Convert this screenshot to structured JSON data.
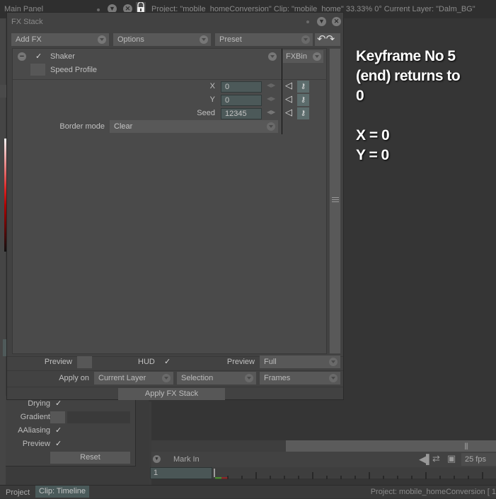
{
  "main_panel": {
    "title": "Main Panel",
    "info": "Project:  \"mobile_homeConversion\"  Clip: \"mobile_home\"   33.33%   0°  Current Layer: \"Dalm_BG\""
  },
  "fx_stack": {
    "title": "FX Stack",
    "toolbar": {
      "add_fx": "Add FX",
      "options": "Options",
      "preset": "Preset"
    },
    "effect": {
      "name": "Shaker",
      "enabled": true,
      "speed_profile_label": "Speed Profile",
      "fxbin_label": "FXBin",
      "params": [
        {
          "label": "X",
          "value": "0"
        },
        {
          "label": "Y",
          "value": "0"
        },
        {
          "label": "Seed",
          "value": "12345"
        }
      ],
      "border_mode_label": "Border mode",
      "border_mode_value": "Clear"
    },
    "bottom": {
      "preview_label": "Preview",
      "hud_label": "HUD",
      "hud_checked": true,
      "preview2_label": "Preview",
      "preview2_value": "Full",
      "apply_on_label": "Apply on",
      "apply_on_value": "Current Layer",
      "selection_value": "Selection",
      "frames_value": "Frames",
      "apply_button": "Apply FX Stack"
    }
  },
  "left_panel": {
    "rows": [
      {
        "label": "Drying",
        "checked": true
      },
      {
        "label": "Gradient",
        "checked": false
      },
      {
        "label": "AAliasing",
        "checked": true
      },
      {
        "label": "Preview",
        "checked": true
      }
    ],
    "reset_button": "Reset"
  },
  "annotation": {
    "text": "Keyframe No 5\n(end) returns to\n0\n\nX = 0\nY = 0"
  },
  "timeline": {
    "mark_in_label": "Mark In",
    "frame_value": "1",
    "fps_value": "25 fps"
  },
  "status_bar": {
    "tab_project": "Project",
    "tab_clip": "Clip: Timeline",
    "right_text": "Project: mobile_homeConversion [ 1"
  },
  "icons": {
    "checkmark": "✓",
    "key": "⚷",
    "undo": "↶",
    "redo": "↷",
    "speaker": "🔈",
    "loop": "⇄",
    "fit": "⛶"
  }
}
